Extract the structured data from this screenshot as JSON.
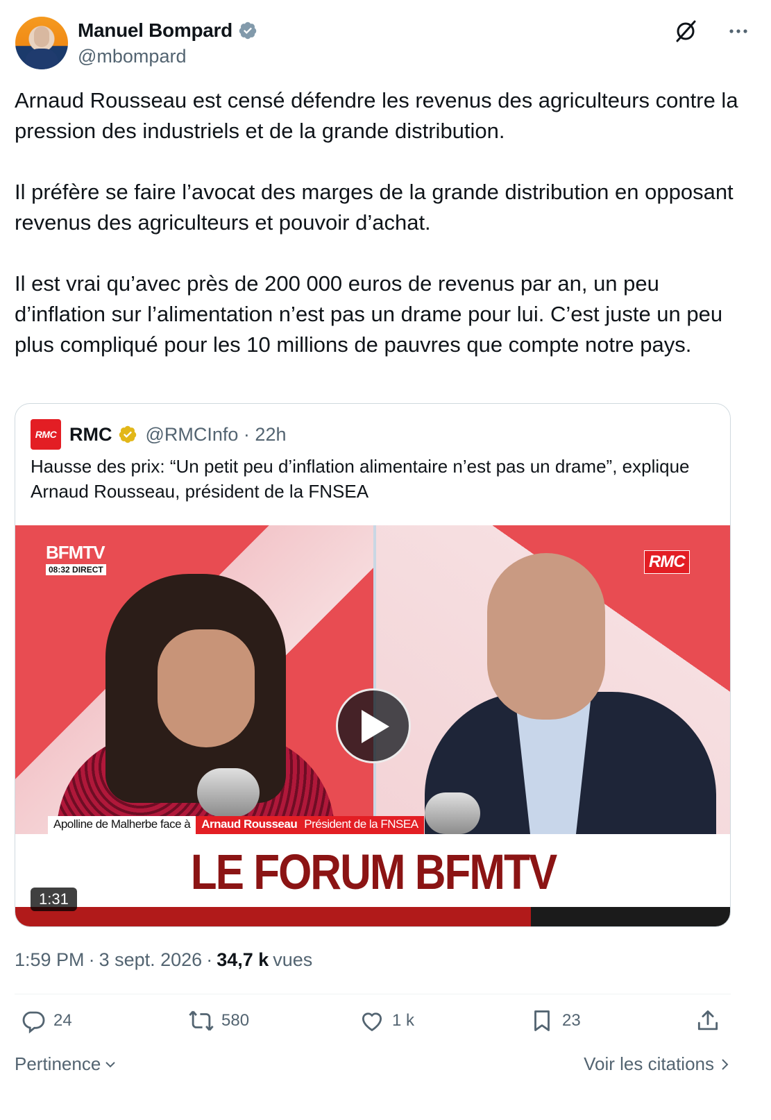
{
  "author": {
    "display_name": "Manuel Bompard",
    "handle": "@mbompard",
    "verified_icon": "verified-badge-icon",
    "avatar_alt": "avatar"
  },
  "tweet": {
    "paragraphs": [
      "Arnaud Rousseau est censé défendre les revenus des agriculteurs contre la pression des industriels et de la grande distribution.",
      "Il préfère se faire l’avocat des marges de la grande distribution en opposant revenus des agriculteurs et pouvoir d’achat.",
      "Il est vrai qu’avec près de 200 000 euros de revenus par an, un peu d’inflation sur l’alimentation n’est pas un drame pour lui. C’est juste un peu plus compliqué pour les 10 millions de pauvres que compte notre pays."
    ]
  },
  "quote": {
    "logo_text": "RMC",
    "name": "RMC",
    "handle_time": "@RMCInfo · 22h",
    "text": "Hausse des prix: “Un petit peu d’inflation alimentaire n’est pas un drame”, explique Arnaud Rousseau, président de la FNSEA",
    "video": {
      "channel": "BFMTV",
      "time_live": "08:32  DIRECT",
      "corner_tag": "RMC",
      "lower_third_left": "Apolline de Malherbe face à",
      "lower_third_name": "Arnaud Rousseau",
      "lower_third_role": "Président de la FNSEA",
      "banner": "LE FORUM BFMTV",
      "duration": "1:31"
    }
  },
  "meta": {
    "time": "1:59 PM",
    "date": "3 sept. 2026",
    "views_count": "34,7 k",
    "views_label": "vues"
  },
  "actions": {
    "replies": "24",
    "reposts": "580",
    "likes": "1 k",
    "bookmarks": "23"
  },
  "footer": {
    "sort_label": "Pertinence",
    "quotes_link": "Voir les citations"
  },
  "colors": {
    "text_primary": "#0f1419",
    "text_secondary": "#536471",
    "verified_blue": "#1d9bf0",
    "gold_badge": "#e2b719",
    "rmc_red": "#e31e24"
  }
}
